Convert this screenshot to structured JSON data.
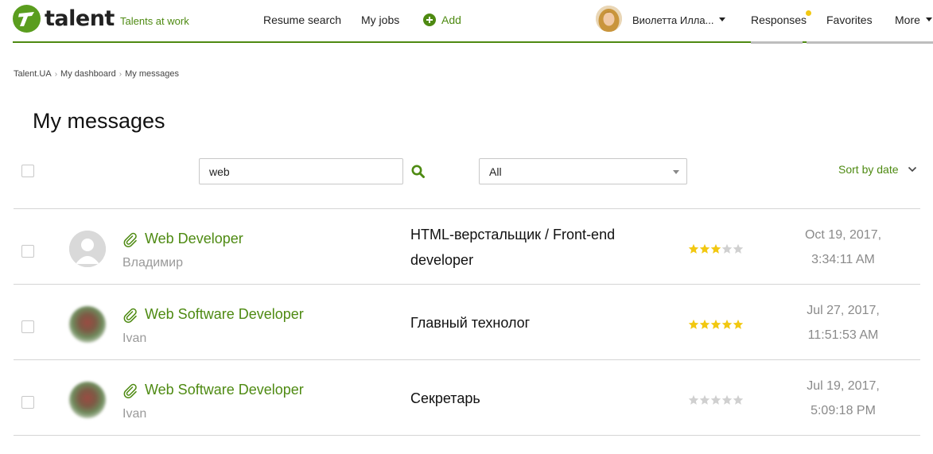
{
  "header": {
    "logo_text": "talent",
    "tagline": "Talents at work",
    "nav": {
      "resume_search": "Resume search",
      "my_jobs": "My jobs",
      "add": "Add",
      "user_name": "Виолетта Илла...",
      "responses": "Responses",
      "favorites": "Favorites",
      "more": "More"
    }
  },
  "breadcrumb": [
    "Talent.UA",
    "My dashboard",
    "My messages"
  ],
  "page_title": "My messages",
  "toolbar": {
    "search_value": "web",
    "filter_value": "All",
    "sort_label": "Sort by date"
  },
  "colors": {
    "brand_green": "#4e8a12",
    "star_filled": "#f2c811",
    "star_empty": "#d0d0d0",
    "notification_dot": "#f2c811"
  },
  "messages": [
    {
      "title": "Web Developer",
      "sender": "Владимир",
      "vacancy_line1": "HTML-верстальщик / Front-end",
      "vacancy_line2": "developer",
      "rating": 3,
      "date": "Oct 19, 2017,",
      "time": "3:34:11 AM",
      "avatar": "default"
    },
    {
      "title": "Web Software Developer",
      "sender": "Ivan",
      "vacancy_line1": "Главный технолог",
      "vacancy_line2": "",
      "rating": 5,
      "date": "Jul 27, 2017,",
      "time": "11:51:53 AM",
      "avatar": "photo"
    },
    {
      "title": "Web Software Developer",
      "sender": "Ivan",
      "vacancy_line1": "Секретарь",
      "vacancy_line2": "",
      "rating": 0,
      "date": "Jul 19, 2017,",
      "time": "5:09:18 PM",
      "avatar": "photo"
    }
  ]
}
